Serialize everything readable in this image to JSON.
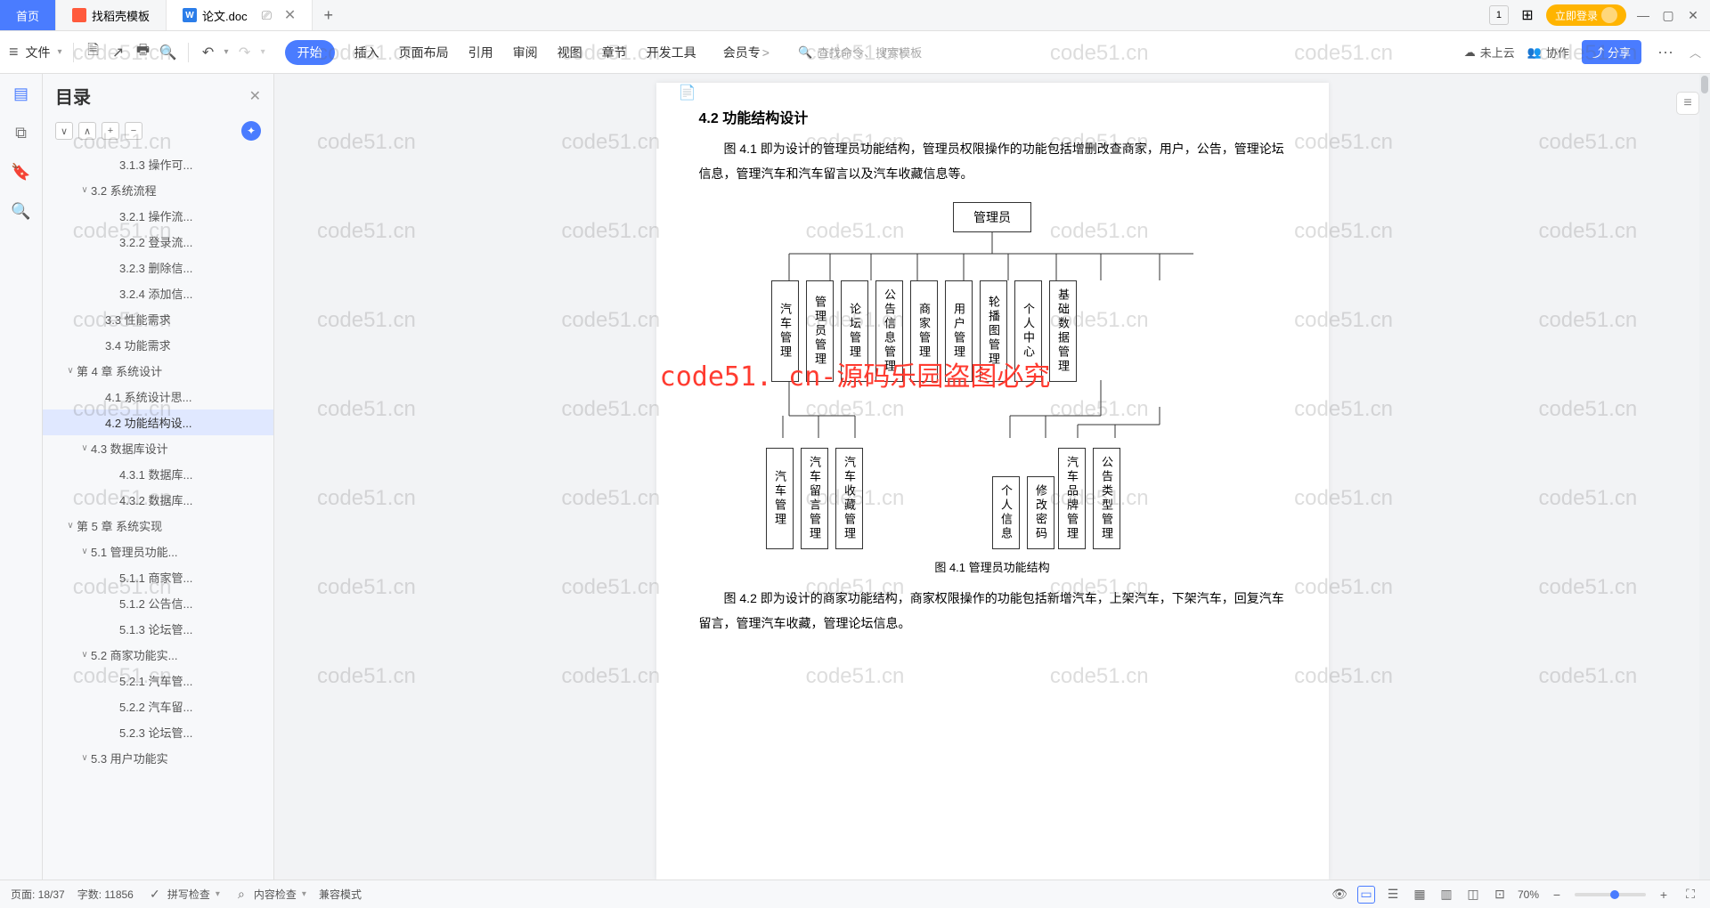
{
  "titlebar": {
    "home": "首页",
    "template_tab": "找稻壳模板",
    "doc_tab": "论文.doc",
    "close": "✕",
    "add": "+",
    "login": "立即登录"
  },
  "toolbar": {
    "file": "文件",
    "menu": [
      "开始",
      "插入",
      "页面布局",
      "引用",
      "审阅",
      "视图",
      "章节",
      "开发工具",
      "会员专"
    ],
    "search_placeholder": "查找命令、搜索模板",
    "cloud": "未上云",
    "collab": "协作",
    "share": "分享",
    "more": "···"
  },
  "outline": {
    "title": "目录",
    "items": [
      {
        "label": "3.1.3 操作可...",
        "depth": 4,
        "toggle": ""
      },
      {
        "label": "3.2 系统流程",
        "depth": 2,
        "toggle": "∨"
      },
      {
        "label": "3.2.1 操作流...",
        "depth": 4,
        "toggle": ""
      },
      {
        "label": "3.2.2 登录流...",
        "depth": 4,
        "toggle": ""
      },
      {
        "label": "3.2.3 删除信...",
        "depth": 4,
        "toggle": ""
      },
      {
        "label": "3.2.4 添加信...",
        "depth": 4,
        "toggle": ""
      },
      {
        "label": "3.3 性能需求",
        "depth": 3,
        "toggle": ""
      },
      {
        "label": "3.4 功能需求",
        "depth": 3,
        "toggle": ""
      },
      {
        "label": "第 4 章  系统设计",
        "depth": 1,
        "toggle": "∨"
      },
      {
        "label": "4.1 系统设计思...",
        "depth": 3,
        "toggle": ""
      },
      {
        "label": "4.2 功能结构设...",
        "depth": 3,
        "selected": true,
        "toggle": ""
      },
      {
        "label": "4.3 数据库设计",
        "depth": 2,
        "toggle": "∨"
      },
      {
        "label": "4.3.1 数据库...",
        "depth": 4,
        "toggle": ""
      },
      {
        "label": "4.3.2 数据库...",
        "depth": 4,
        "toggle": ""
      },
      {
        "label": "第 5 章  系统实现",
        "depth": 1,
        "toggle": "∨"
      },
      {
        "label": "5.1 管理员功能...",
        "depth": 2,
        "toggle": "∨"
      },
      {
        "label": "5.1.1 商家管...",
        "depth": 4,
        "toggle": ""
      },
      {
        "label": "5.1.2 公告信...",
        "depth": 4,
        "toggle": ""
      },
      {
        "label": "5.1.3 论坛管...",
        "depth": 4,
        "toggle": ""
      },
      {
        "label": "5.2 商家功能实...",
        "depth": 2,
        "toggle": "∨"
      },
      {
        "label": "5.2.1 汽车管...",
        "depth": 4,
        "toggle": ""
      },
      {
        "label": "5.2.2 汽车留...",
        "depth": 4,
        "toggle": ""
      },
      {
        "label": "5.2.3 论坛管...",
        "depth": 4,
        "toggle": ""
      },
      {
        "label": "5.3 用户功能实",
        "depth": 2,
        "toggle": "∨"
      }
    ]
  },
  "document": {
    "section_no": "4.2",
    "section_title": "功能结构设计",
    "para1": "图 4.1 即为设计的管理员功能结构，管理员权限操作的功能包括增删改查商家，用户，公告，管理论坛信息，管理汽车和汽车留言以及汽车收藏信息等。",
    "admin_root": "管理员",
    "row1": [
      "汽车管理",
      "管理员管理",
      "论坛管理",
      "公告信息管理",
      "商家管理",
      "用户管理",
      "轮播图管理",
      "个人中心",
      "基础数据管理"
    ],
    "row2a": [
      "汽车管理",
      "汽车留言管理",
      "汽车收藏管理"
    ],
    "row2b": [
      "个人信息",
      "修改密码"
    ],
    "row2c": [
      "汽车品牌管理",
      "公告类型管理"
    ],
    "fig_caption": "图 4.1 管理员功能结构",
    "para2": "图 4.2 即为设计的商家功能结构，商家权限操作的功能包括新增汽车，上架汽车，下架汽车，回复汽车留言，管理汽车收藏，管理论坛信息。"
  },
  "watermark": {
    "text": "code51.cn",
    "red": "code51. cn-源码乐园盗图必究"
  },
  "statusbar": {
    "page": "页面: 18/37",
    "words": "字数: 11856",
    "spellcheck": "拼写检查",
    "content_check": "内容检查",
    "compat": "兼容模式",
    "zoom": "70%"
  }
}
